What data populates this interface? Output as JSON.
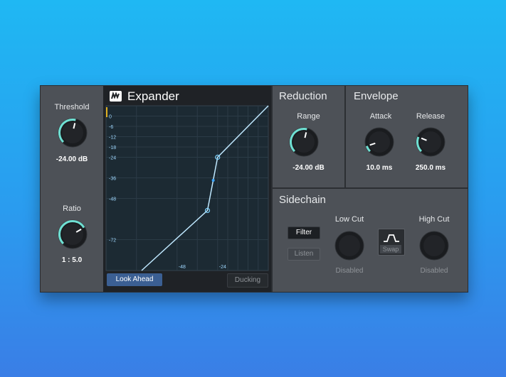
{
  "plugin": {
    "title": "Expander",
    "brand_icon": "presonus-logo-icon"
  },
  "left": {
    "threshold": {
      "label": "Threshold",
      "value": "-24.00 dB",
      "level": 0.55
    },
    "ratio": {
      "label": "Ratio",
      "value": "1 : 5.0",
      "level": 0.72
    }
  },
  "graph": {
    "y_ticks": [
      "0",
      "-6",
      "-12",
      "-18",
      "-24",
      "-36",
      "-48",
      "-72"
    ],
    "x_ticks": [
      "-48",
      "-24"
    ],
    "look_ahead_label": "Look Ahead",
    "ducking_label": "Ducking"
  },
  "reduction": {
    "title": "Reduction",
    "range": {
      "label": "Range",
      "value": "-24.00 dB",
      "level": 0.55
    }
  },
  "envelope": {
    "title": "Envelope",
    "attack": {
      "label": "Attack",
      "value": "10.0 ms",
      "level": 0.1
    },
    "release": {
      "label": "Release",
      "value": "250.0 ms",
      "level": 0.25
    }
  },
  "sidechain": {
    "title": "Sidechain",
    "filter_label": "Filter",
    "listen_label": "Listen",
    "low_cut": {
      "label": "Low Cut",
      "value": "Disabled"
    },
    "swap_label": "Swap",
    "high_cut": {
      "label": "High Cut",
      "value": "Disabled"
    }
  },
  "colors": {
    "accent": "#6fe0d3",
    "curve": "#bfe8ff",
    "active_button": "#3b5f93"
  }
}
